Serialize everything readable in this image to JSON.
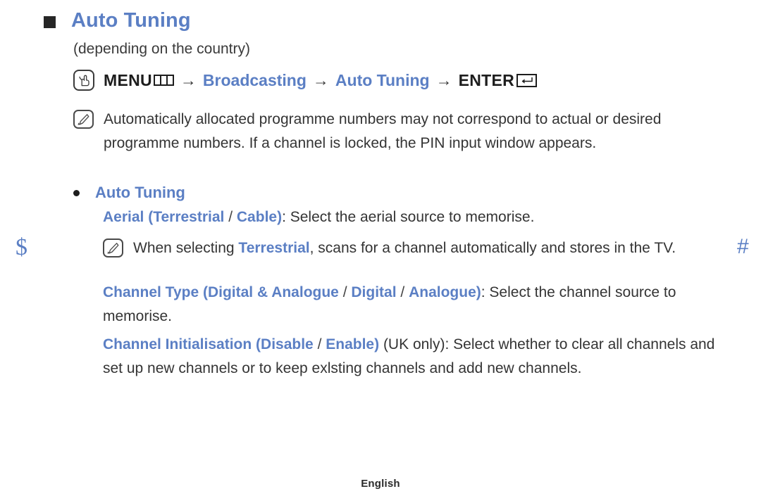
{
  "page": {
    "title": "Auto Tuning",
    "subtitle": "(depending on the country)",
    "footer_language": "English",
    "accent_color": "#5b7fc4",
    "text_color": "#343434"
  },
  "side_markers": {
    "left_symbol": "$",
    "right_symbol": "#"
  },
  "menu_path": {
    "icon": "menu-press-hand-icon",
    "menu_label": "MENU",
    "menu_glyph": "menu-bars-icon",
    "arrow": "→",
    "step_broadcasting": "Broadcasting",
    "step_auto_tuning": "Auto Tuning",
    "enter_label": "ENTER",
    "enter_glyph": "enter-return-icon"
  },
  "note_1": {
    "icon": "note-pen-icon",
    "text": "Automatically allocated programme numbers may not correspond to actual or desired programme numbers. If a channel is locked, the PIN input window appears."
  },
  "bullet": {
    "marker": "•",
    "label": "Auto Tuning"
  },
  "para_aerial": {
    "term": "Aerial (",
    "option_1": "Terrestrial",
    "separator": " / ",
    "option_2": "Cable",
    "term_close": ")",
    "description": ": Select the aerial source to memorise."
  },
  "note_2": {
    "icon": "note-pen-icon",
    "text_before": "When selecting ",
    "highlight": "Terrestrial",
    "text_after": ", scans for a channel automatically and stores in the TV."
  },
  "para_channel_type": {
    "term": "Channel Type (",
    "option_1": "Digital & Analogue",
    "separator_1": " / ",
    "option_2": "Digital",
    "separator_2": " / ",
    "option_3": "Analogue",
    "term_close": ")",
    "description": ": Select the channel source to memorise."
  },
  "para_channel_init": {
    "term": "Channel Initialisation (",
    "option_1": "Disable",
    "separator": " / ",
    "option_2": "Enable",
    "term_close": ")",
    "description": " (UK only): Select whether to clear all channels and set up new channels or to keep exlsting channels and add new channels."
  }
}
